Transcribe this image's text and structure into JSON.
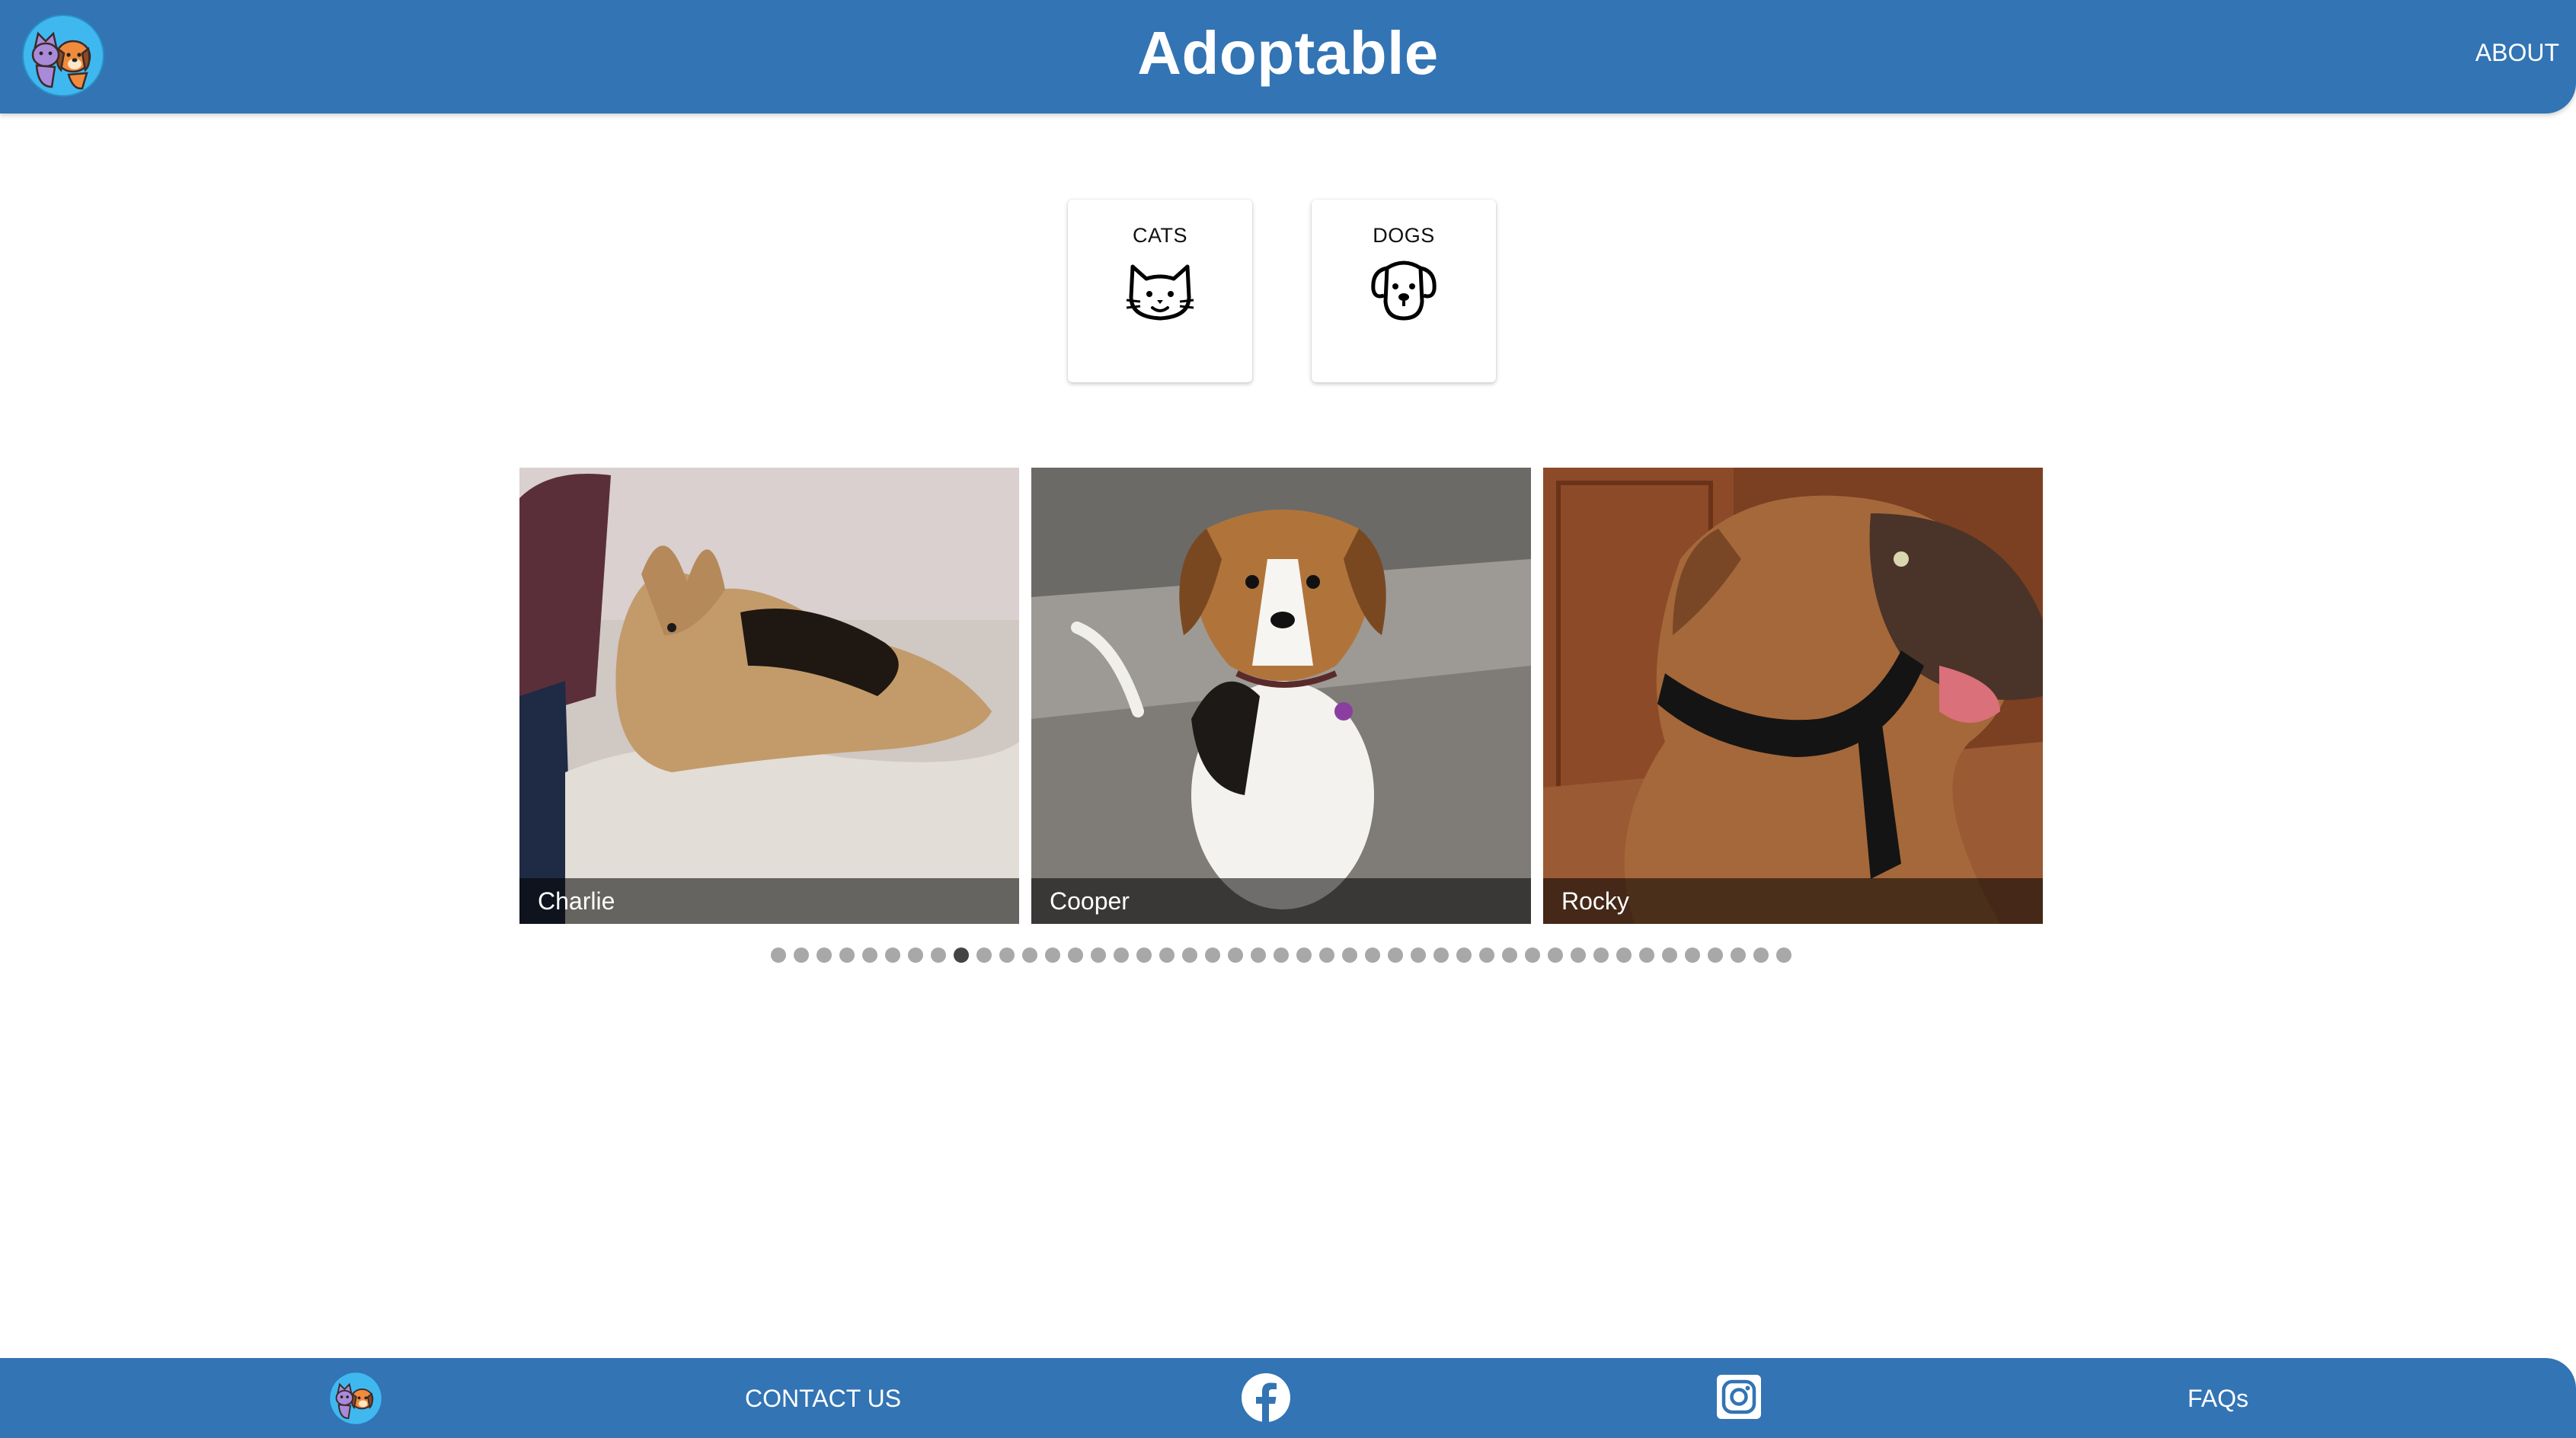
{
  "header": {
    "title": "Adoptable",
    "about_label": "ABOUT",
    "logo_icon": "cat-and-dog-logo-icon",
    "background": "#3274b4"
  },
  "categories": [
    {
      "label": "CATS",
      "icon": "cat-face-icon"
    },
    {
      "label": "DOGS",
      "icon": "dog-face-icon"
    }
  ],
  "carousel": {
    "items": [
      {
        "name": "Charlie"
      },
      {
        "name": "Cooper"
      },
      {
        "name": "Rocky"
      }
    ],
    "dot_count": 45,
    "active_index": 8
  },
  "footer": {
    "logo_icon": "cat-and-dog-logo-icon",
    "contact_label": "CONTACT US",
    "facebook_icon": "facebook-icon",
    "instagram_icon": "instagram-icon",
    "faqs_label": "FAQs",
    "background": "#3274b4"
  }
}
